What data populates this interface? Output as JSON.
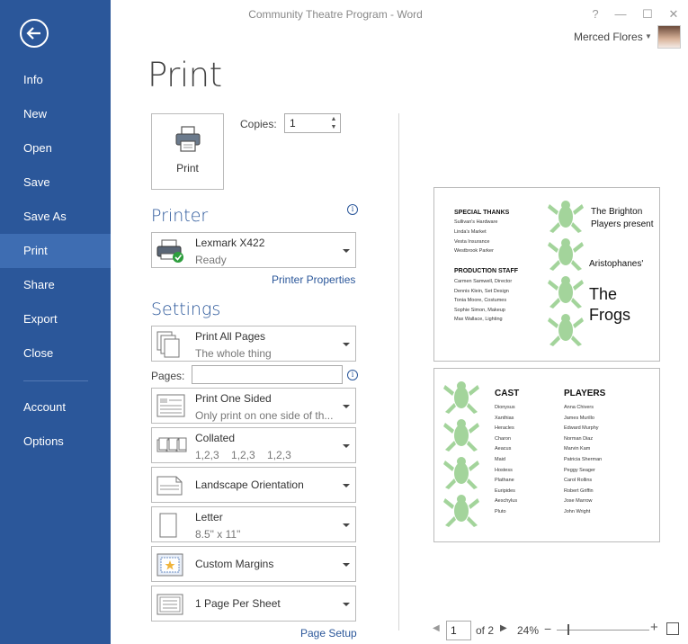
{
  "window": {
    "title": "Community Theatre Program - Word",
    "help": "?",
    "minimize": "—",
    "restore": "☐",
    "close": "✕"
  },
  "user": {
    "name": "Merced Flores"
  },
  "sidebar": {
    "items": [
      {
        "label": "Info"
      },
      {
        "label": "New"
      },
      {
        "label": "Open"
      },
      {
        "label": "Save"
      },
      {
        "label": "Save As"
      },
      {
        "label": "Print"
      },
      {
        "label": "Share"
      },
      {
        "label": "Export"
      },
      {
        "label": "Close"
      },
      {
        "label": "Account"
      },
      {
        "label": "Options"
      }
    ],
    "active": "Print"
  },
  "page": {
    "title": "Print"
  },
  "print": {
    "button_label": "Print",
    "copies_label": "Copies:",
    "copies_value": "1"
  },
  "printer": {
    "heading": "Printer",
    "name": "Lexmark X422",
    "status": "Ready",
    "properties_link": "Printer Properties"
  },
  "settings": {
    "heading": "Settings",
    "pages_label": "Pages:",
    "pages_value": "",
    "dropdowns": [
      {
        "title": "Print All Pages",
        "sub": "The whole thing"
      },
      {
        "title": "Print One Sided",
        "sub": "Only print on one side of th..."
      },
      {
        "title": "Collated",
        "sub": "1,2,3    1,2,3    1,2,3"
      },
      {
        "title": "Landscape Orientation",
        "sub": ""
      },
      {
        "title": "Letter",
        "sub": "8.5\" x 11\""
      },
      {
        "title": "Custom Margins",
        "sub": ""
      },
      {
        "title": "1 Page Per Sheet",
        "sub": ""
      }
    ],
    "page_setup_link": "Page Setup"
  },
  "preview": {
    "page1": {
      "special_thanks_h": "SPECIAL THANKS",
      "special_thanks": [
        "Sullivan's Hardware",
        "Linda's Market",
        "Vesta Insurance",
        "Westbrook Parker"
      ],
      "production_h": "PRODUCTION STAFF",
      "production": [
        "Carmen Samwell, Director",
        "Dennis Klein, Set Design",
        "Tonia Moore, Costumes",
        "Sophie Simon, Makeup",
        "Max Wallace, Lighting"
      ],
      "line1": "The Brighton",
      "line2": "Players present",
      "author": "Aristophanes'",
      "title1": "The",
      "title2": "Frogs"
    },
    "page2": {
      "cast_h": "CAST",
      "cast": [
        "Dionysus",
        "Xanthias",
        "Heracles",
        "Charon",
        "Aeacus",
        "Maid",
        "Hostess",
        "Plathane",
        "Euripides",
        "Aeschylus",
        "Pluto"
      ],
      "players_h": "PLAYERS",
      "players": [
        "Anna Chivers",
        "James Murillo",
        "Edward Murphy",
        "Norman Diaz",
        "Marvin Kam",
        "Patricia Sherman",
        "Peggy Seager",
        "Carol Rollins",
        "Robert Griffin",
        "Jose Marrow",
        "John Wright"
      ]
    },
    "frog_color": "#a3d49b"
  },
  "pager": {
    "current": "1",
    "of": "of 2",
    "zoom": "24%",
    "zoom_fraction": 0.12
  },
  "colors": {
    "accent": "#2b579a"
  }
}
